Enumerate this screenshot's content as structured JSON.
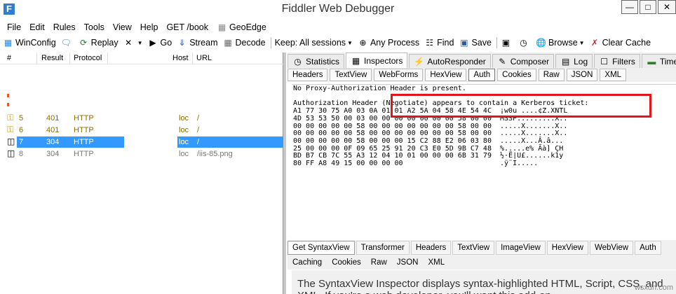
{
  "window": {
    "title": "Fiddler Web Debugger",
    "icon_letter": "F",
    "minimize": "—",
    "maximize": "□",
    "close": "✕"
  },
  "menu": [
    "File",
    "Edit",
    "Rules",
    "Tools",
    "View",
    "Help",
    "GET /book",
    "GeoEdge"
  ],
  "toolbar": {
    "winconfig": "WinConfig",
    "replay": "Replay",
    "go": "Go",
    "stream": "Stream",
    "decode": "Decode",
    "keep": "Keep: All sessions",
    "any_process": "Any Process",
    "find": "Find",
    "save": "Save",
    "browse": "Browse",
    "clear_cache": "Clear Cache"
  },
  "sessions": {
    "columns": [
      "#",
      "Result",
      "Protocol",
      "Host",
      "URL"
    ],
    "rows": [
      {
        "num": "5",
        "result": "401",
        "protocol": "HTTP",
        "host": "loc",
        "url": "/",
        "color": "#8a6d00"
      },
      {
        "num": "6",
        "result": "401",
        "protocol": "HTTP",
        "host": "loc",
        "url": "/",
        "color": "#8a6d00"
      },
      {
        "num": "7",
        "result": "304",
        "protocol": "HTTP",
        "host": "loc",
        "url": "/",
        "color": "#ffffff"
      },
      {
        "num": "8",
        "result": "304",
        "protocol": "HTTP",
        "host": "loc",
        "url": "/iis-85.png",
        "color": "#777777"
      }
    ]
  },
  "right_tabs": [
    "Statistics",
    "Inspectors",
    "AutoResponder",
    "Composer",
    "Log",
    "Filters",
    "Timeline"
  ],
  "request_tabs": [
    "Headers",
    "TextView",
    "WebForms",
    "HexView",
    "Auth",
    "Cookies",
    "Raw",
    "JSON",
    "XML"
  ],
  "auth_text": [
    "No Proxy-Authorization Header is present.",
    "",
    "Authorization Header (Negotiate) appears to contain a Kerberos ticket:",
    "A1 77 30 75 A0 03 0A 01 01 A2 5A 04 58 4E 54 4C  ¡w0u ....¢Z.XNTL",
    "4D 53 53 50 00 03 00 00 00 00 00 00 00 58 00 00  MSSP.........X..",
    "00 00 00 00 00 58 00 00 00 00 00 00 00 58 00 00  .....X.......X..",
    "00 00 00 00 00 58 00 00 00 00 00 00 00 58 00 00  .....X.......X..",
    "00 00 00 00 00 58 00 00 00 15 C2 88 E2 06 03 80  .....X...Â.â...",
    "25 00 00 00 0F 09 65 25 91 20 C3 E0 5D 9B C7 48  %.....e% Ãà] ÇH",
    "BD B7 CB 7C 55 A3 12 04 10 01 00 00 00 6B 31 79  ½·Ë|U£......k1y",
    "80 FF A8 49 15 00 00 00 00                       .ÿ¨I....."
  ],
  "response_tabs_row1": [
    "Get SyntaxView",
    "Transformer",
    "Headers",
    "TextView",
    "ImageView",
    "HexView",
    "WebView",
    "Auth"
  ],
  "response_tabs_row2": [
    "Caching",
    "Cookies",
    "Raw",
    "JSON",
    "XML"
  ],
  "syntax_message": "The SyntaxView Inspector displays syntax-highlighted HTML, Script, CSS, and XML. If you're a web developer, you'll want this add-on.",
  "watermark": "wsxdn.com",
  "accent_color": "#3399ff",
  "highlight_color": "#e0161c"
}
